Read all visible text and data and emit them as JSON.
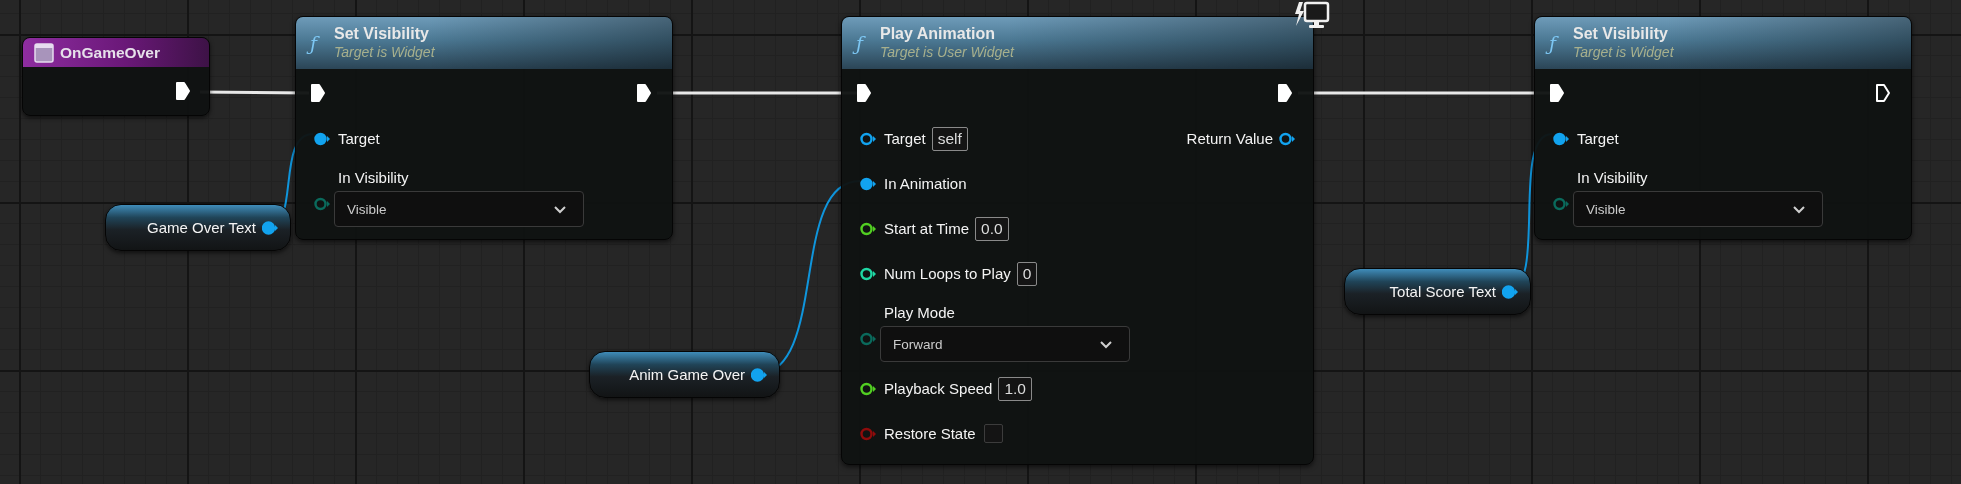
{
  "nodes": [
    {
      "kind": "event",
      "title": "OnGameOver",
      "exec_out": {
        "connected": true
      }
    },
    {
      "kind": "variable",
      "label": "Game Over Text",
      "color": "#12a3ef",
      "connected": true
    },
    {
      "kind": "function",
      "icon": "ƒ",
      "title": "Set Visibility",
      "subtitle": "Target is Widget",
      "exec_in": {
        "connected": true
      },
      "exec_out": {
        "connected": true
      },
      "rows": [
        {
          "kind": "pin",
          "color": "#12a3ef",
          "label": "Target",
          "connected": true
        },
        {
          "kind": "enum",
          "color": "#0a6a5c",
          "label": "In Visibility",
          "connected": false,
          "value": "Visible"
        }
      ]
    },
    {
      "kind": "variable",
      "label": "Anim Game Over",
      "color": "#12a3ef",
      "connected": true
    },
    {
      "kind": "function",
      "icon": "ƒ",
      "title": "Play Animation",
      "subtitle": "Target is User Widget",
      "network_badge": true,
      "exec_in": {
        "connected": true
      },
      "exec_out": {
        "connected": true
      },
      "rows": [
        {
          "kind": "pin",
          "color": "#12a3ef",
          "label": "Target",
          "connected": false,
          "default": "self",
          "output": {
            "label": "Return Value",
            "color": "#12a3ef",
            "connected": false
          }
        },
        {
          "kind": "pin",
          "color": "#12a3ef",
          "label": "In Animation",
          "connected": true
        },
        {
          "kind": "pin",
          "color": "#52cf22",
          "label": "Start at Time",
          "connected": false,
          "default": "0.0"
        },
        {
          "kind": "pin",
          "color": "#1fd8a4",
          "label": "Num Loops to Play",
          "connected": false,
          "default": "0"
        },
        {
          "kind": "enum",
          "color": "#0a6a5c",
          "label": "Play Mode",
          "connected": false,
          "value": "Forward"
        },
        {
          "kind": "pin",
          "color": "#52cf22",
          "label": "Playback Speed",
          "connected": false,
          "default": "1.0"
        },
        {
          "kind": "checkbox",
          "color": "#8f0b0b",
          "label": "Restore State",
          "connected": false,
          "checked": false
        }
      ]
    },
    {
      "kind": "variable",
      "label": "Total Score Text",
      "color": "#12a3ef",
      "connected": true
    },
    {
      "kind": "function",
      "icon": "ƒ",
      "title": "Set Visibility",
      "subtitle": "Target is Widget",
      "exec_in": {
        "connected": true
      },
      "exec_out": {
        "connected": false
      },
      "rows": [
        {
          "kind": "pin",
          "color": "#12a3ef",
          "label": "Target",
          "connected": true
        },
        {
          "kind": "enum",
          "color": "#0a6a5c",
          "label": "In Visibility",
          "connected": false,
          "value": "Visible"
        }
      ]
    }
  ]
}
